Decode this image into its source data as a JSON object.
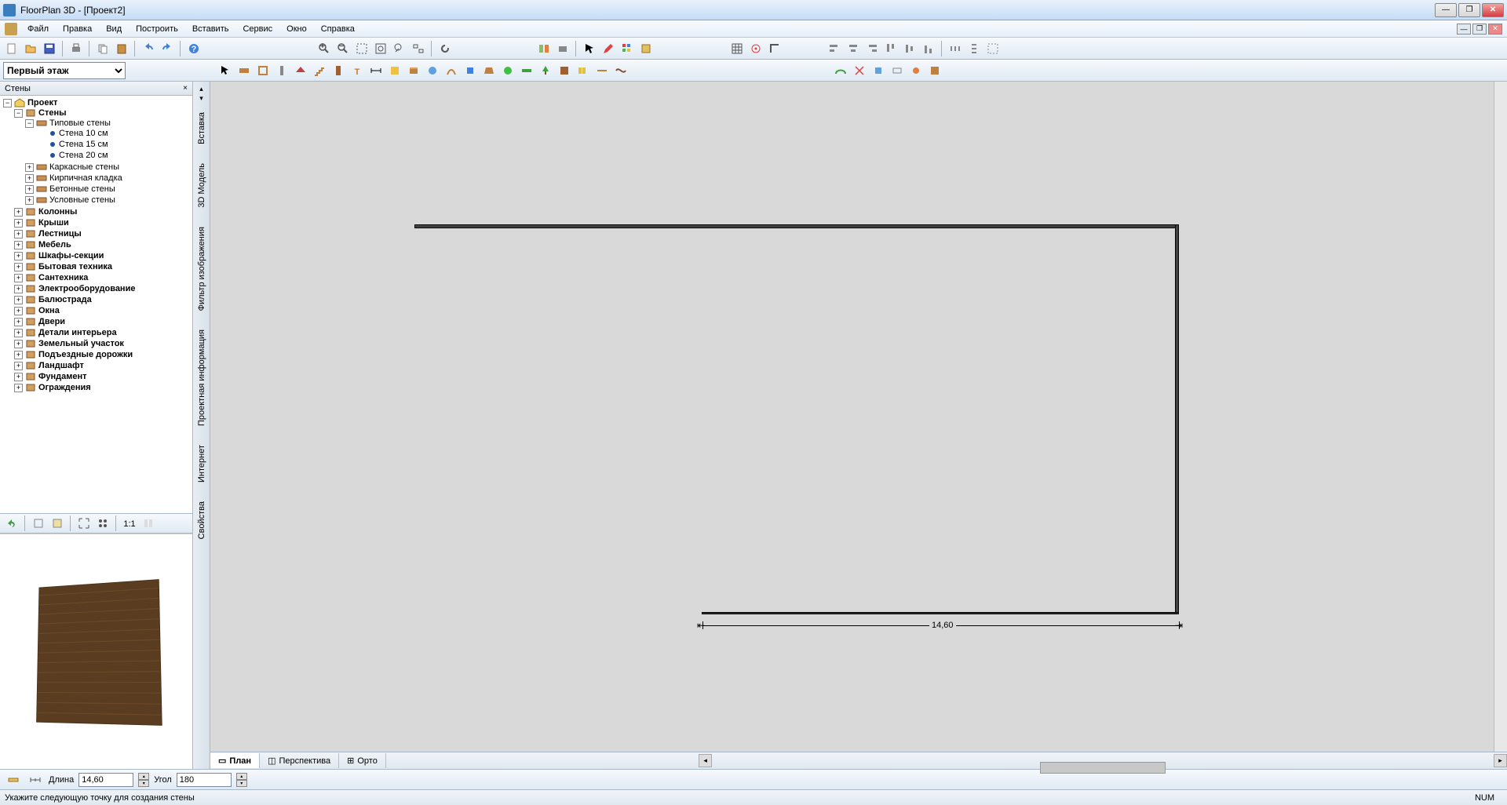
{
  "title": "FloorPlan 3D - [Проект2]",
  "menu": [
    "Файл",
    "Правка",
    "Вид",
    "Построить",
    "Вставить",
    "Сервис",
    "Окно",
    "Справка"
  ],
  "floor_selected": "Первый этаж",
  "panel_title": "Стены",
  "tree": {
    "root": "Проект",
    "walls": "Стены",
    "walls_children": [
      {
        "label": "Типовые стены",
        "expanded": true,
        "kids": [
          "Стена 10 см",
          "Стена 15 см",
          "Стена 20 см"
        ]
      },
      {
        "label": "Каркасные стены"
      },
      {
        "label": "Кирпичная кладка"
      },
      {
        "label": "Бетонные стены"
      },
      {
        "label": "Условные стены"
      }
    ],
    "cats": [
      "Колонны",
      "Крыши",
      "Лестницы",
      "Мебель",
      "Шкафы-секции",
      "Бытовая техника",
      "Сантехника",
      "Электрооборудование",
      "Балюстрада",
      "Окна",
      "Двери",
      "Детали интерьера",
      "Земельный участок",
      "Подъездные дорожки",
      "Ландшафт",
      "Фундамент",
      "Ограждения"
    ]
  },
  "vtabs": [
    "Вставка",
    "3D Модель",
    "Фильтр изображения",
    "Проектная информация",
    "Интернет",
    "Свойства"
  ],
  "view_tabs": [
    "План",
    "Перспектива",
    "Орто"
  ],
  "dim_value": "14,60",
  "bottom": {
    "length_label": "Длина",
    "length_value": "14,60",
    "angle_label": "Угол",
    "angle_value": "180"
  },
  "status_text": "Укажите следующую точку для создания стены",
  "status_num": "NUM"
}
